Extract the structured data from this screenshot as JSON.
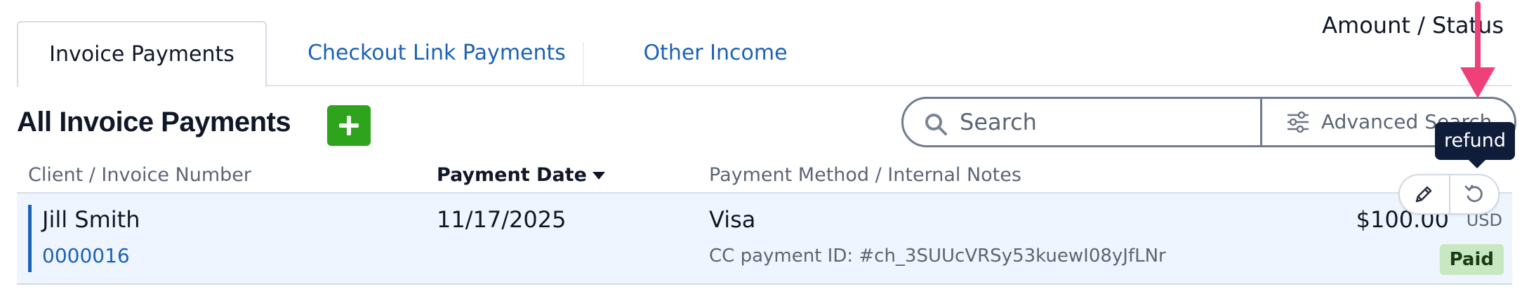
{
  "tabs": [
    {
      "label": "Invoice Payments",
      "active": true
    },
    {
      "label": "Checkout Link Payments",
      "active": false
    },
    {
      "label": "Other Income",
      "active": false
    }
  ],
  "header": {
    "title": "All Invoice Payments"
  },
  "search": {
    "placeholder": "Search",
    "advanced_label": "Advanced Search"
  },
  "table": {
    "columns": {
      "client": "Client / Invoice Number",
      "date": "Payment Date",
      "method": "Payment Method / Internal Notes",
      "amount": "Amount / Status"
    },
    "rows": [
      {
        "client": "Jill Smith",
        "invoice": "0000016",
        "date": "11/17/2025",
        "method": "Visa",
        "notes": "CC payment ID: #ch_3SUUcVRSy53kuewI08yJfLNr",
        "amount": "$100.00",
        "currency": "USD",
        "status": "Paid"
      }
    ]
  },
  "tooltip": {
    "text": "refund"
  },
  "colors": {
    "accent_link": "#1c62b6",
    "add_button": "#2ea31c",
    "paid_badge": "#c7e8c0",
    "row_highlight": "#eef5fe",
    "tooltip_bg": "#0f1d3a",
    "annotation_arrow": "#f0407a"
  },
  "icons": {
    "add": "plus-icon",
    "search": "search-icon",
    "advanced": "sliders-icon",
    "sort": "caret-down-icon",
    "edit": "pencil-icon",
    "refund": "refund-icon"
  }
}
